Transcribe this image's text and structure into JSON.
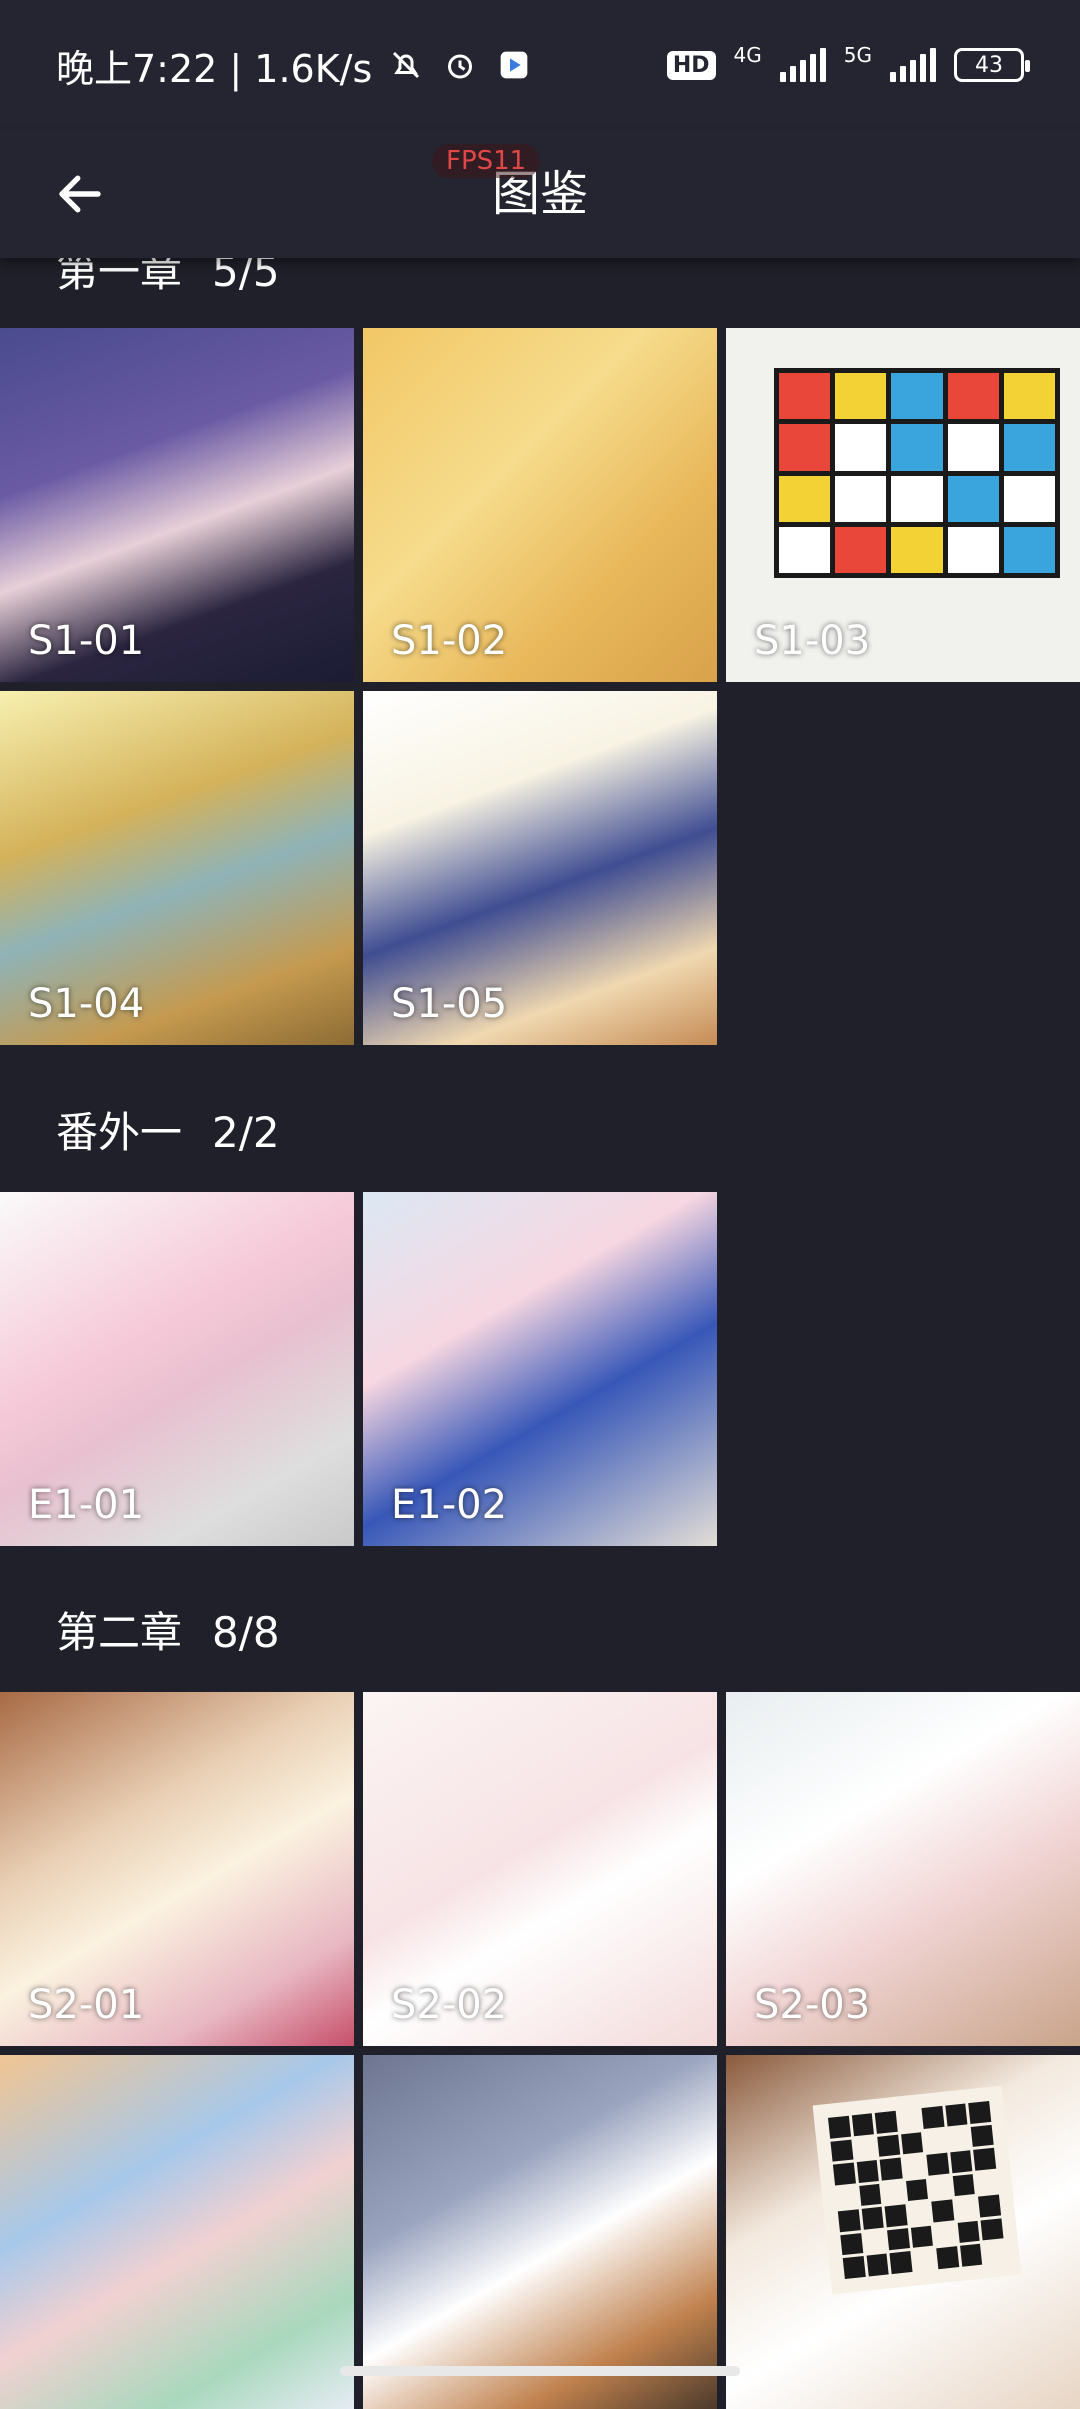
{
  "status_bar": {
    "time": "晚上7:22 | 1.6K/s",
    "hd": "HD",
    "net1": "4G",
    "net2": "5G",
    "battery": "43"
  },
  "app_bar": {
    "title": "图鉴",
    "fps": "FPS11"
  },
  "sections": [
    {
      "name": "第一章",
      "count": "5/5",
      "items": [
        "S1-01",
        "S1-02",
        "S1-03",
        "S1-04",
        "S1-05"
      ]
    },
    {
      "name": "番外一",
      "count": "2/2",
      "items": [
        "E1-01",
        "E1-02"
      ]
    },
    {
      "name": "第二章",
      "count": "8/8",
      "items": [
        "S2-01",
        "S2-02",
        "S2-03"
      ]
    }
  ],
  "colors": {
    "background": "#1f2029",
    "bar": "#242530",
    "fps_text": "#e04848"
  }
}
